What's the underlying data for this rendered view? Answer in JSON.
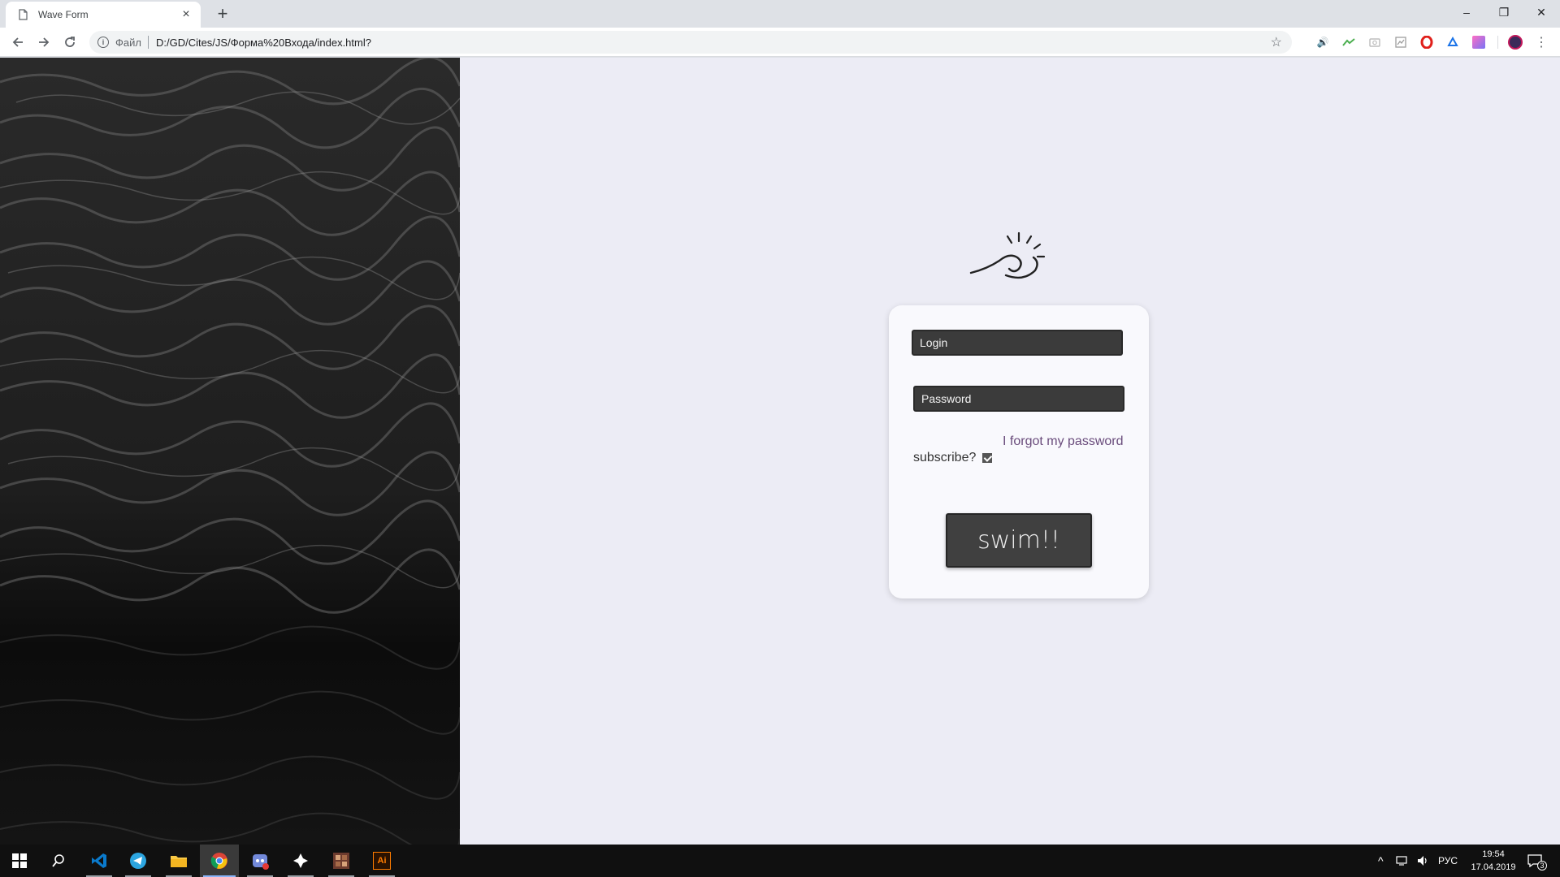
{
  "browser": {
    "tab_title": "Wave Form",
    "new_tab_symbol": "+",
    "close_tab_symbol": "×",
    "scheme_label": "Файл",
    "url": "D:/GD/Cites/JS/Форма%20Входа/index.html?",
    "window_controls": {
      "minimize": "–",
      "restore": "❐",
      "close": "✕"
    },
    "extensions": [
      "volume-icon",
      "graph-icon",
      "camera-icon",
      "chart-icon",
      "opera-icon",
      "bell-icon",
      "gradient-icon",
      "avatar-icon",
      "menu-icon"
    ]
  },
  "page": {
    "login_placeholder": "Login",
    "password_placeholder": "Password",
    "forgot_link": "I forgot my password",
    "subscribe_label": "subscribe?",
    "subscribe_checked": true,
    "submit_label": "swim!!",
    "colors": {
      "background": "#ececf5",
      "card": "#f9f9fd",
      "field": "#3b3b3b",
      "link": "#6a4c7c",
      "button": "#404040"
    }
  },
  "taskbar": {
    "apps": [
      "windows-start-icon",
      "search-icon",
      "vscode-icon",
      "telegram-icon",
      "file-explorer-icon",
      "chrome-icon",
      "discord-icon",
      "app-icon",
      "photo-app-icon",
      "illustrator-icon"
    ],
    "language": "РУС",
    "time": "19:54",
    "date": "17.04.2019",
    "notifications_count": "3",
    "illustrator_label": "Ai"
  }
}
